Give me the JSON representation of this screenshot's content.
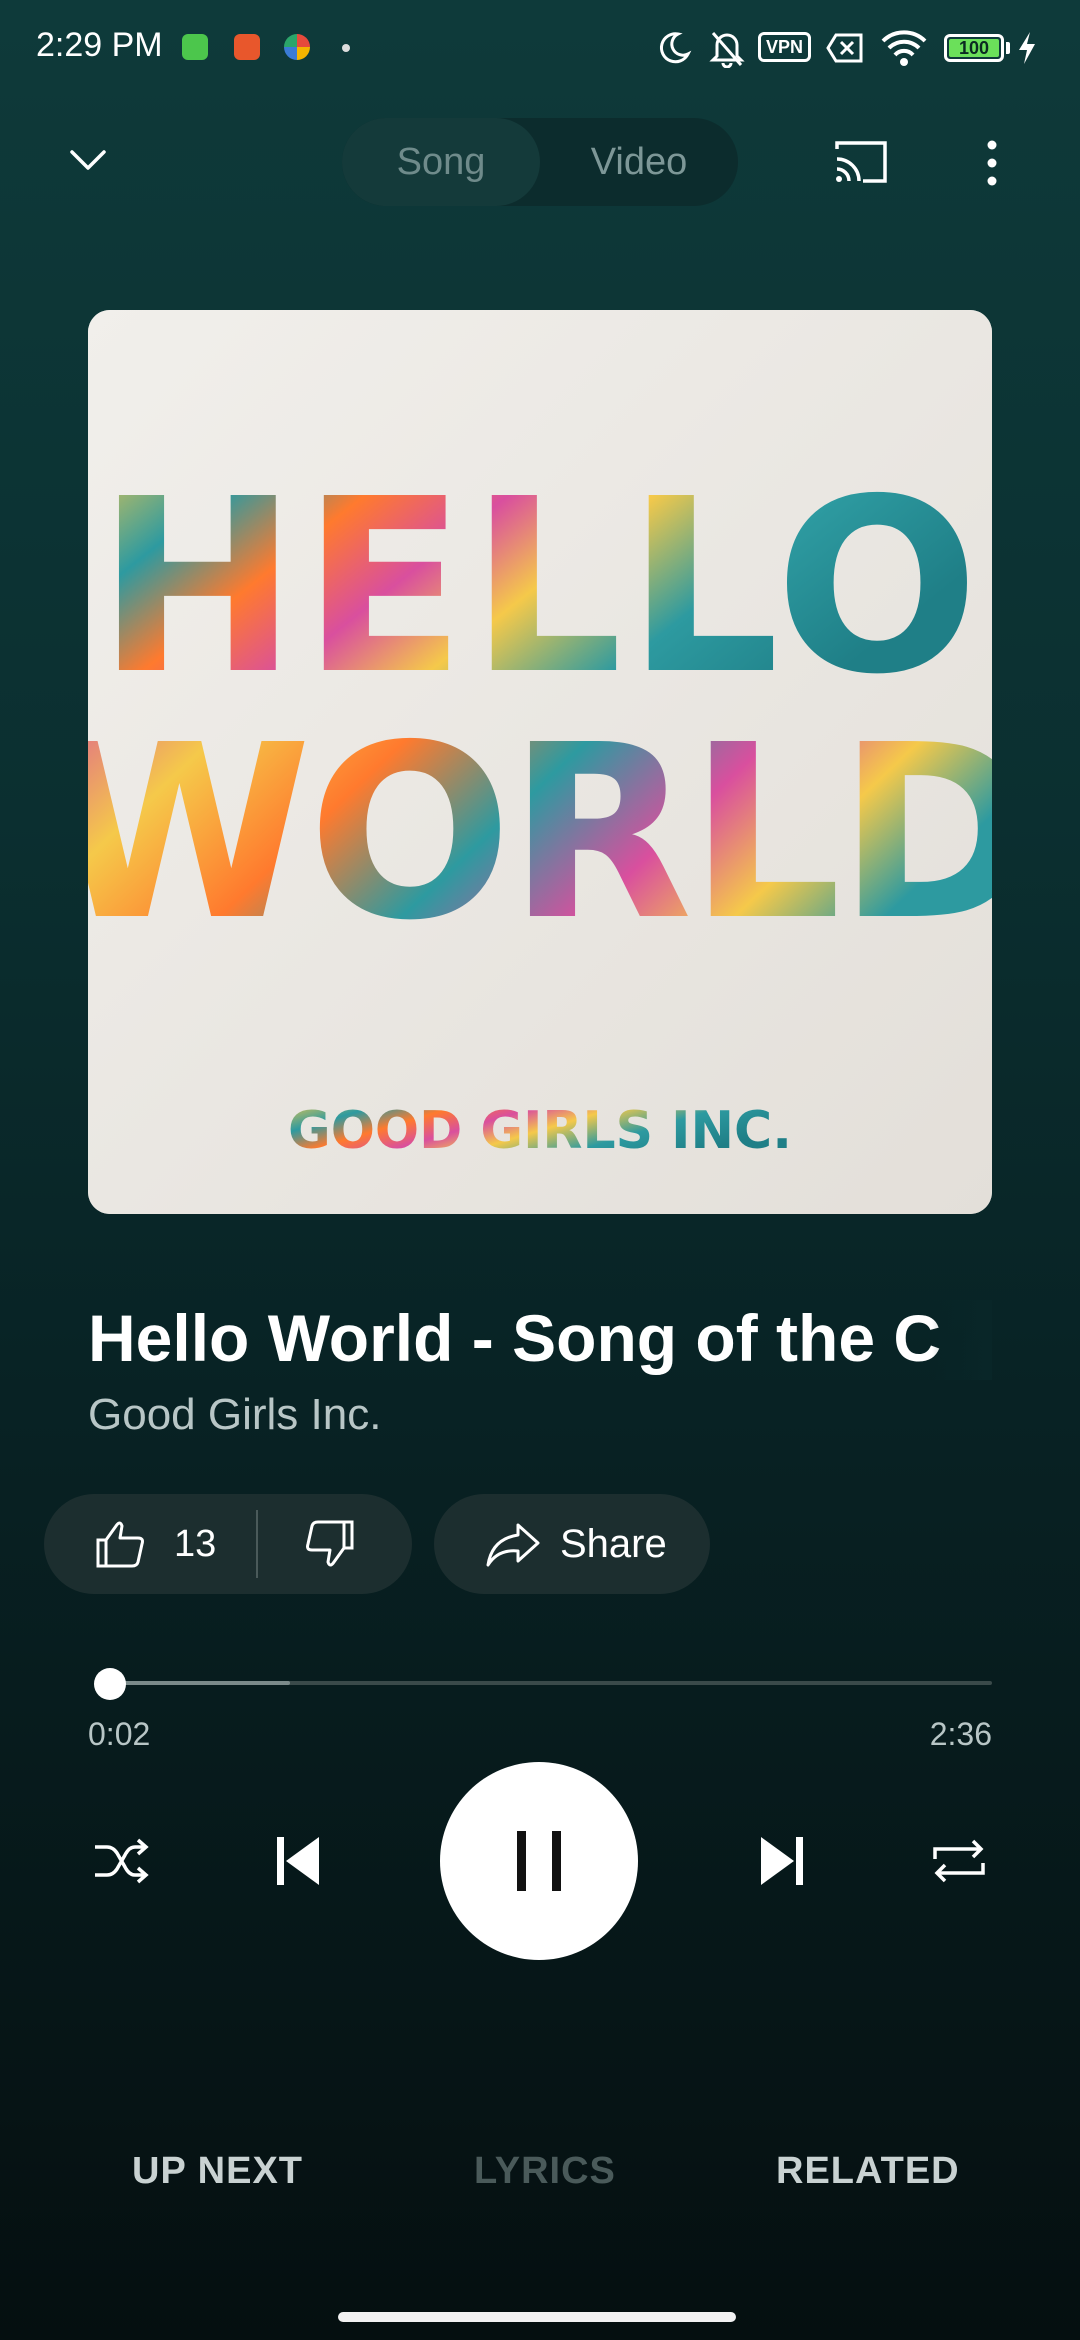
{
  "status_bar": {
    "time": "2:29 PM",
    "vpn": "VPN",
    "battery": "100"
  },
  "top_bar": {
    "collapse_icon": "chevron-down-icon",
    "tabs": [
      {
        "label": "Song",
        "selected": true
      },
      {
        "label": "Video",
        "selected": false
      }
    ],
    "cast_icon": "cast-icon",
    "menu_icon": "more-vert-icon"
  },
  "album": {
    "line1": "HELLO",
    "line2": "WORLD",
    "band": "GOOD GIRLS INC."
  },
  "track": {
    "title": "Hello World - Song of the C",
    "artist": "Good Girls Inc."
  },
  "actions": {
    "like_count": "13",
    "share_label": "Share"
  },
  "progress": {
    "current": "0:02",
    "total": "2:36",
    "played_fraction": 0.013,
    "buffered_fraction": 0.215
  },
  "controls": {
    "shuffle_icon": "shuffle-icon",
    "prev_icon": "skip-previous-icon",
    "play_state": "playing",
    "next_icon": "skip-next-icon",
    "repeat_icon": "repeat-icon"
  },
  "bottom_tabs": [
    {
      "label": "UP NEXT"
    },
    {
      "label": "LYRICS"
    },
    {
      "label": "RELATED"
    }
  ],
  "colors": {
    "background_top": "#0e3a3a",
    "background_bottom": "#050f10",
    "accent": "#ffffff"
  }
}
